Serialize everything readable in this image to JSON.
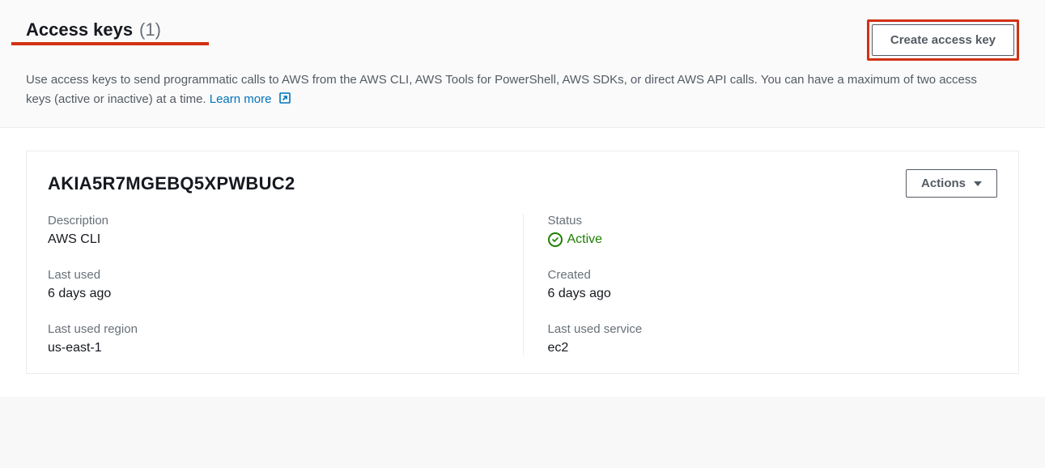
{
  "header": {
    "title": "Access keys",
    "count": "(1)",
    "description_part1": "Use access keys to send programmatic calls to AWS from the AWS CLI, AWS Tools for PowerShell, AWS SDKs, or direct AWS API calls. You can have a maximum of two access keys (active or inactive) at a time. ",
    "learn_more": "Learn more",
    "create_button": "Create access key"
  },
  "key": {
    "id": "AKIA5R7MGEBQ5XPWBUC2",
    "actions_label": "Actions",
    "fields": {
      "description_label": "Description",
      "description_value": "AWS CLI",
      "status_label": "Status",
      "status_value": "Active",
      "last_used_label": "Last used",
      "last_used_value": "6 days ago",
      "created_label": "Created",
      "created_value": "6 days ago",
      "last_used_region_label": "Last used region",
      "last_used_region_value": "us-east-1",
      "last_used_service_label": "Last used service",
      "last_used_service_value": "ec2"
    }
  }
}
